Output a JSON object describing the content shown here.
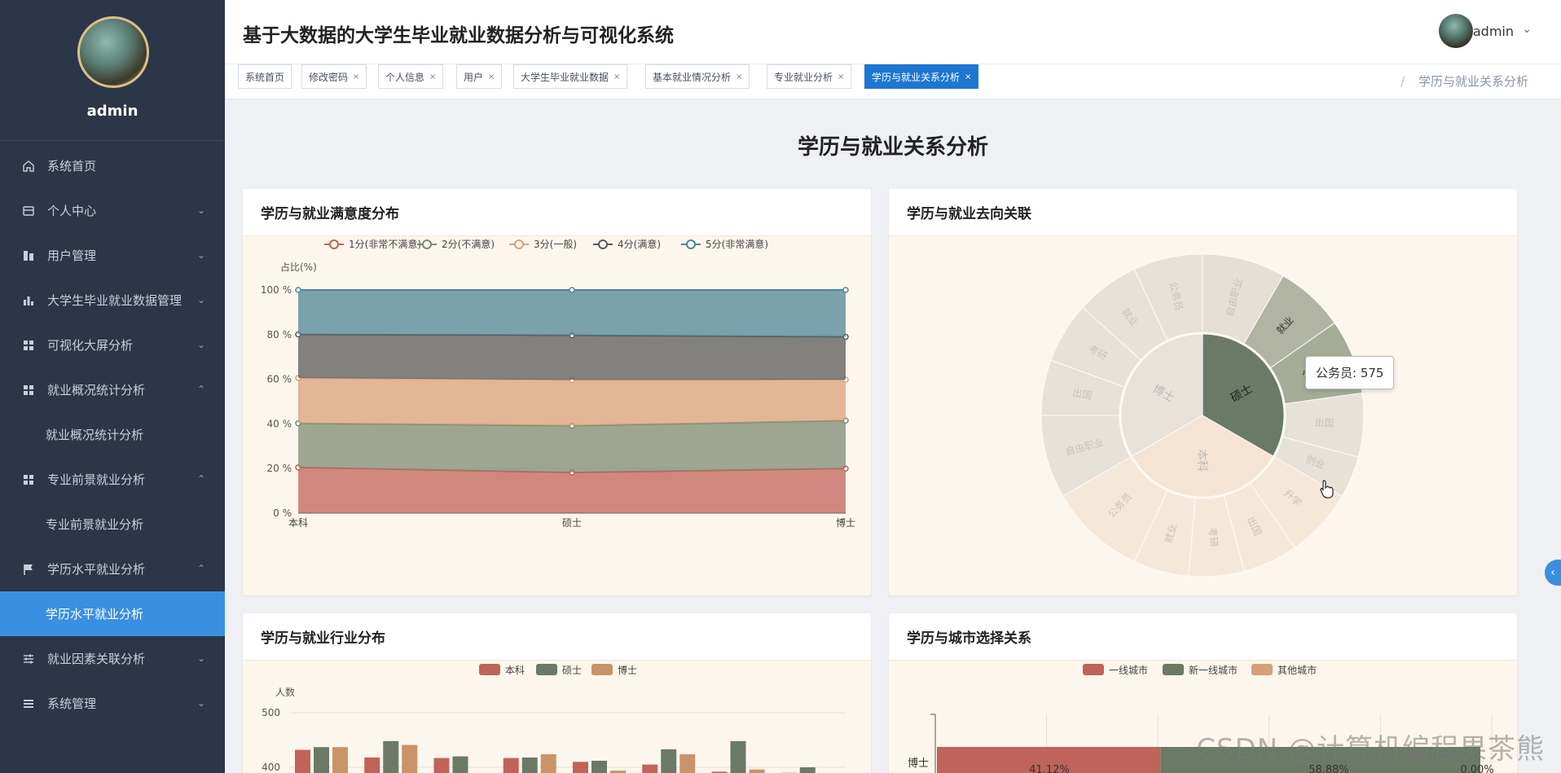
{
  "sidebar": {
    "username": "admin",
    "menu": [
      {
        "label": "系统首页",
        "icon": "home-icon",
        "chev": ""
      },
      {
        "label": "个人中心",
        "icon": "profile-icon",
        "chev": "⌄"
      },
      {
        "label": "用户管理",
        "icon": "users-icon",
        "chev": "⌄"
      },
      {
        "label": "大学生毕业就业数据管理",
        "icon": "bar-icon",
        "chev": "⌄"
      },
      {
        "label": "可视化大屏分析",
        "icon": "grid-icon",
        "chev": "⌄"
      },
      {
        "label": "就业概况统计分析",
        "icon": "grid-icon",
        "chev": "⌃"
      },
      {
        "label": "专业前景就业分析",
        "icon": "grid-icon",
        "chev": "⌃"
      },
      {
        "label": "学历水平就业分析",
        "icon": "flag-icon",
        "chev": "⌃"
      },
      {
        "label": "就业因素关联分析",
        "icon": "sliders-icon",
        "chev": "⌄"
      },
      {
        "label": "系统管理",
        "icon": "list-icon",
        "chev": "⌄"
      }
    ],
    "subs": {
      "employment_overview": "就业概况统计分析",
      "major_prospect": "专业前景就业分析",
      "education_level": "学历水平就业分析"
    }
  },
  "header": {
    "title": "基于大数据的大学生毕业就业数据分析与可视化系统",
    "user": "admin",
    "caret": "⌄"
  },
  "tags": [
    {
      "label": "系统首页",
      "closable": false,
      "active": false
    },
    {
      "label": "修改密码",
      "closable": true,
      "active": false
    },
    {
      "label": "个人信息",
      "closable": true,
      "active": false
    },
    {
      "label": "用户",
      "closable": true,
      "active": false
    },
    {
      "label": "大学生毕业就业数据",
      "closable": true,
      "active": false
    },
    {
      "label": "基本就业情况分析",
      "closable": true,
      "active": false
    },
    {
      "label": "专业就业分析",
      "closable": true,
      "active": false
    },
    {
      "label": "学历与就业关系分析",
      "closable": true,
      "active": true
    }
  ],
  "breadcrumb": {
    "sep": "/",
    "current": "学历与就业关系分析"
  },
  "page_title": "学历与就业关系分析",
  "cards": {
    "satisfaction": "学历与就业满意度分布",
    "destination": "学历与就业去向关联",
    "industry": "学历与就业行业分布",
    "city": "学历与城市选择关系"
  },
  "tooltip": "公务员: 575",
  "watermark": "CSDN @计算机编程果茶熊",
  "colors": {
    "red": "#c0635a",
    "green": "#6b7a65",
    "tan": "#d4a07a",
    "dark": "#555555",
    "teal": "#4e8698",
    "sidebar": "#2b3648",
    "accent": "#3b8fe0"
  },
  "chart_data": [
    {
      "type": "area",
      "title": "学历与就业满意度分布",
      "categories": [
        "本科",
        "硕士",
        "博士"
      ],
      "ylabel": "占比(%)",
      "ylim": [
        0,
        100
      ],
      "yticks": [
        "0 %",
        "20 %",
        "40 %",
        "60 %",
        "80 %",
        "100 %"
      ],
      "stacked": true,
      "legend_position": "top",
      "series": [
        {
          "name": "1分(非常不满意)",
          "values": [
            20.5,
            18.2,
            20.0
          ],
          "color": "#c0635a"
        },
        {
          "name": "2分(不满意)",
          "values": [
            19.8,
            21.0,
            21.5
          ],
          "color": "#7d8b74"
        },
        {
          "name": "3分(一般)",
          "values": [
            20.3,
            20.5,
            18.3
          ],
          "color": "#d9a07a"
        },
        {
          "name": "4分(满意)",
          "values": [
            19.5,
            20.0,
            19.2
          ],
          "color": "#5a5a5a"
        },
        {
          "name": "5分(非常满意)",
          "values": [
            19.9,
            20.3,
            21.0
          ],
          "color": "#4e8698"
        }
      ]
    },
    {
      "type": "sunburst",
      "title": "学历与就业去向关联",
      "inner": [
        {
          "name": "硕士",
          "color": "#6b7a65",
          "highlight": true
        },
        {
          "name": "本科",
          "color": "#f0d6c0"
        },
        {
          "name": "博士",
          "color": "#d9d3cc"
        }
      ],
      "outer_labels": [
        "自由职业",
        "就业",
        "公务员",
        "出国",
        "创业",
        "升学",
        "出国",
        "考研",
        "就业",
        "公务员",
        "自由职业",
        "出国",
        "考研",
        "就业",
        "公务员",
        "创业"
      ],
      "highlighted": {
        "name": "公务员",
        "value": 575
      }
    },
    {
      "type": "bar",
      "title": "学历与就业行业分布",
      "ylabel": "人数",
      "yticks": [
        "400",
        "500"
      ],
      "series": [
        {
          "name": "本科",
          "color": "#c0635a"
        },
        {
          "name": "硕士",
          "color": "#6b7a65"
        },
        {
          "name": "博士",
          "color": "#c9946a"
        }
      ],
      "groups": [
        [
          432,
          437,
          437
        ],
        [
          418,
          448,
          441
        ],
        [
          417,
          420,
          386
        ],
        [
          417,
          418,
          424
        ],
        [
          410,
          412,
          394
        ],
        [
          405,
          433,
          424
        ],
        [
          392,
          448,
          396
        ],
        [
          390,
          400,
          0
        ]
      ]
    },
    {
      "type": "bar",
      "orientation": "horizontal",
      "stacked": true,
      "title": "学历与城市选择关系",
      "series": [
        {
          "name": "一线城市",
          "color": "#c0635a"
        },
        {
          "name": "新一线城市",
          "color": "#6b7a65"
        },
        {
          "name": "其他城市",
          "color": "#d4a07a"
        }
      ],
      "categories": [
        "博士"
      ],
      "labels": [
        "41.12%",
        "58.88%",
        "0.00%"
      ],
      "values": [
        41.12,
        58.88,
        0.0
      ]
    }
  ]
}
